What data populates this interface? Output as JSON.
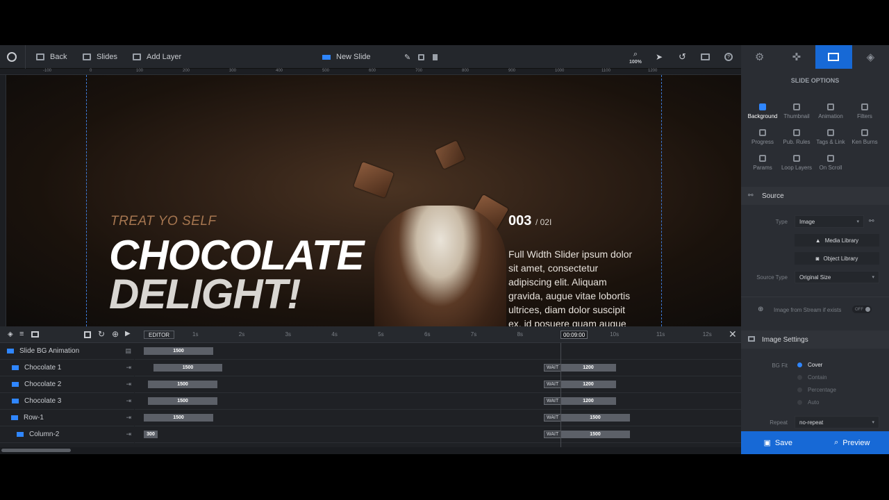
{
  "toolbar": {
    "back": "Back",
    "slides": "Slides",
    "add_layer": "Add Layer",
    "slide_name": "New Slide",
    "zoom": "100%"
  },
  "ruler": {
    "ticks": [
      "-100",
      "0",
      "100",
      "200",
      "300",
      "400",
      "500",
      "600",
      "700",
      "800",
      "900",
      "1000",
      "1100",
      "1200"
    ]
  },
  "side_tabs": [
    "gear-icon",
    "puzzle-icon",
    "slide-options-icon",
    "layers-icon"
  ],
  "slide": {
    "subtitle": "TREAT YO SELF",
    "title_line1": "CHOCOLATE",
    "title_line2": "DELIGHT!",
    "number": "003",
    "number_total": "/ 02I",
    "body": "Full Width Slider ipsum dolor sit amet, consectetur adipiscing elit. Aliquam gravida, augue vitae lobortis ultrices, diam dolor suscipit ex, id posuere quam augue"
  },
  "timeline": {
    "editor_label": "EDITOR",
    "current_time": "00:09:00",
    "seconds": [
      "1s",
      "2s",
      "3s",
      "4s",
      "5s",
      "6s",
      "7s",
      "8s",
      "9s",
      "10s",
      "11s",
      "12s"
    ],
    "rows": [
      {
        "label": "Slide BG Animation",
        "bar": "1500",
        "wait": "",
        "bar2": ""
      },
      {
        "label": "Chocolate 1",
        "bar": "1500",
        "wait": "WAIT",
        "bar2": "1200"
      },
      {
        "label": "Chocolate 2",
        "bar": "1500",
        "wait": "WAIT",
        "bar2": "1200"
      },
      {
        "label": "Chocolate 3",
        "bar": "1500",
        "wait": "WAIT",
        "bar2": "1200"
      },
      {
        "label": "Row-1",
        "bar": "1500",
        "wait": "WAIT",
        "bar2": "1500"
      },
      {
        "label": "Column-2",
        "bar": "300",
        "wait": "WAIT",
        "bar2": "1500"
      }
    ]
  },
  "panel": {
    "title": "SLIDE OPTIONS",
    "options": [
      "Background",
      "Thumbnail",
      "Animation",
      "Filters",
      "Progress",
      "Pub. Rules",
      "Tags & Link",
      "Ken Burns",
      "Params",
      "Loop Layers",
      "On Scroll"
    ],
    "source_head": "Source",
    "type_label": "Type",
    "type_value": "Image",
    "media_library": "Media Library",
    "object_library": "Object Library",
    "source_type_label": "Source Type",
    "source_type_value": "Original Size",
    "stream_label": "Image from Stream if exists",
    "stream_toggle": "OFF",
    "image_settings_head": "Image Settings",
    "bg_fit_label": "BG Fit",
    "bg_fit_options": [
      "Cover",
      "Contain",
      "Percentage",
      "Auto"
    ],
    "repeat_label": "Repeat",
    "repeat_value": "no-repeat"
  },
  "footer": {
    "save": "Save",
    "preview": "Preview"
  },
  "colors": {
    "accent": "#1769d6",
    "panel": "#2a2d33",
    "toolbar": "#24272c"
  }
}
